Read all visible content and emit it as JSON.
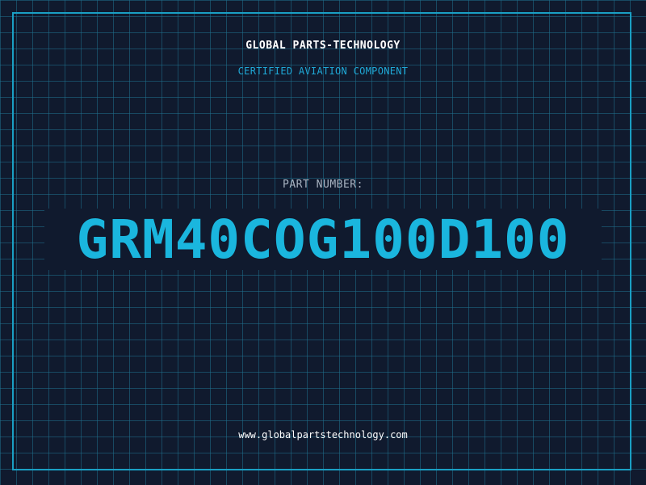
{
  "header": {
    "brand_name": "GLOBAL PARTS-TECHNOLOGY",
    "tagline": "CERTIFIED AVIATION COMPONENT"
  },
  "main": {
    "part_label": "PART NUMBER:",
    "part_number": "GRM40COG100D100"
  },
  "footer": {
    "website": "www.globalpartstechnology.com"
  },
  "colors": {
    "background": "#101a2e",
    "grid": "#1f6f8c",
    "accent": "#1ab6de",
    "frame": "#1a9fc4",
    "label": "#a9b4c2",
    "text": "#ffffff"
  }
}
